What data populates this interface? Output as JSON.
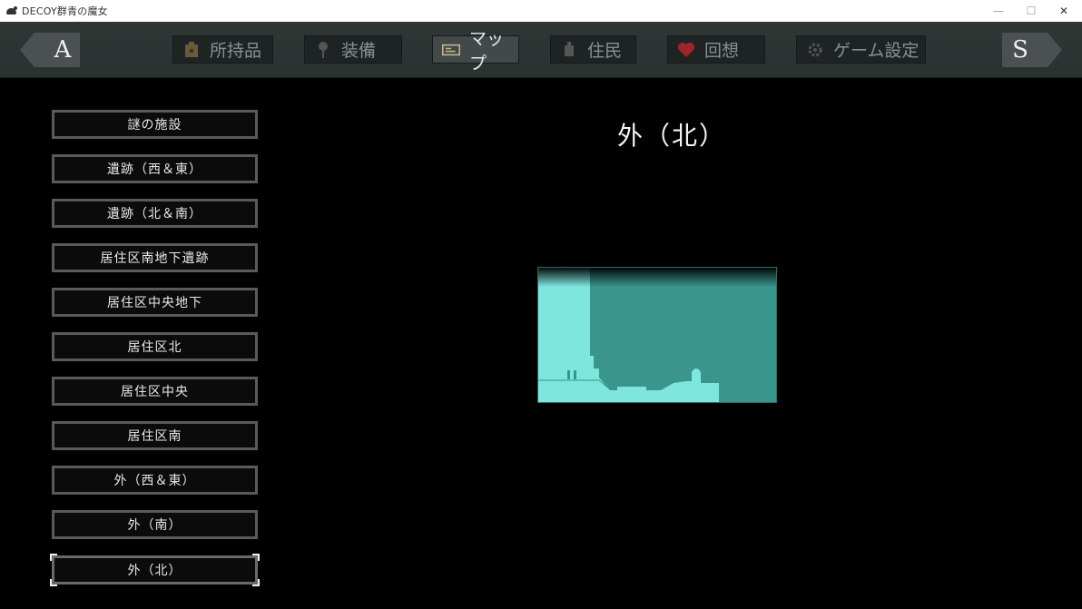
{
  "window": {
    "title": "DECOY群青の魔女",
    "minimize": "—",
    "maximize": "☐",
    "close": "✕"
  },
  "menu": {
    "prev_key": "A",
    "next_key": "S",
    "tabs": [
      {
        "label": "所持品",
        "icon": "bag-icon"
      },
      {
        "label": "装備",
        "icon": "sword-icon"
      },
      {
        "label": "マップ",
        "icon": "map-icon",
        "active": true
      },
      {
        "label": "住民",
        "icon": "resident-icon"
      },
      {
        "label": "回想",
        "icon": "heart-icon"
      },
      {
        "label": "ゲーム設定",
        "icon": "gear-icon"
      }
    ]
  },
  "locations": [
    "謎の施設",
    "遺跡（西＆東）",
    "遺跡（北＆南）",
    "居住区南地下遺跡",
    "居住区中央地下",
    "居住区北",
    "居住区中央",
    "居住区南",
    "外（西＆東）",
    "外（南）",
    "外（北）"
  ],
  "selected_location": "外（北）",
  "map": {
    "title": "外（北）",
    "colors": {
      "explored": "#7ee6dc",
      "unexplored": "#3a958d",
      "background": "#000000"
    }
  }
}
